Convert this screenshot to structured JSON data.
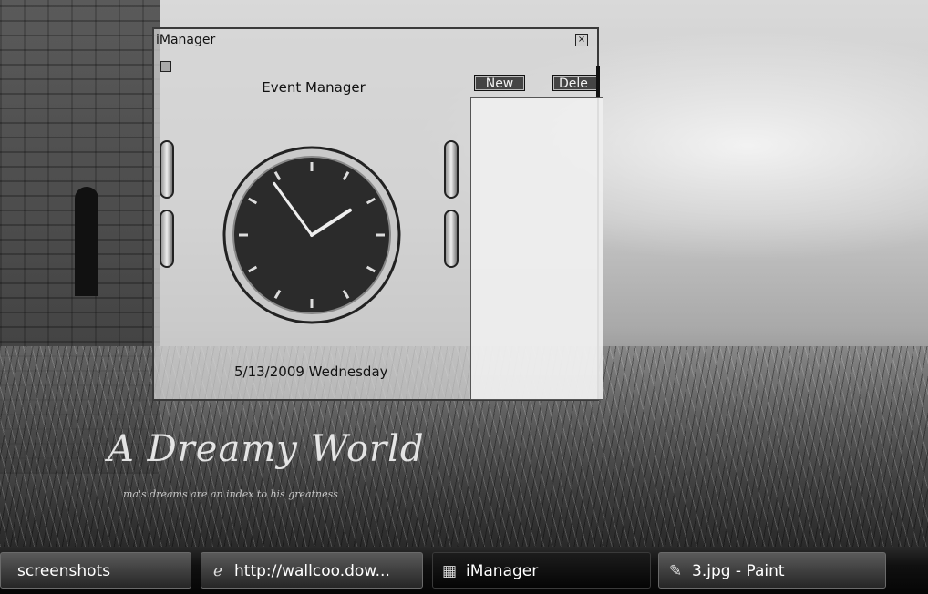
{
  "window": {
    "title": "iManager",
    "close_icon": "close-icon",
    "menu_icon": "menu-icon",
    "heading": "Event Manager",
    "date_text": "5/13/2009 Wednesday",
    "buttons": {
      "new": "New",
      "delete": "Dele"
    },
    "clock": {
      "hour": 1,
      "minute": 54
    }
  },
  "wallpaper": {
    "title": "A Dreamy World",
    "subtitle": "ma's dreams are an index to his greatness"
  },
  "taskbar": {
    "items": [
      {
        "label": "screenshots",
        "icon": "folder-icon"
      },
      {
        "label": "http://wallcoo.dow...",
        "icon": "internet-explorer-icon"
      },
      {
        "label": "iManager",
        "icon": "imanager-icon",
        "active": true
      },
      {
        "label": "3.jpg - Paint",
        "icon": "paint-icon"
      }
    ]
  },
  "colors": {
    "window_border": "#3a3a3a",
    "taskbar": "#101010",
    "clock_face": "#2b2b2b"
  }
}
